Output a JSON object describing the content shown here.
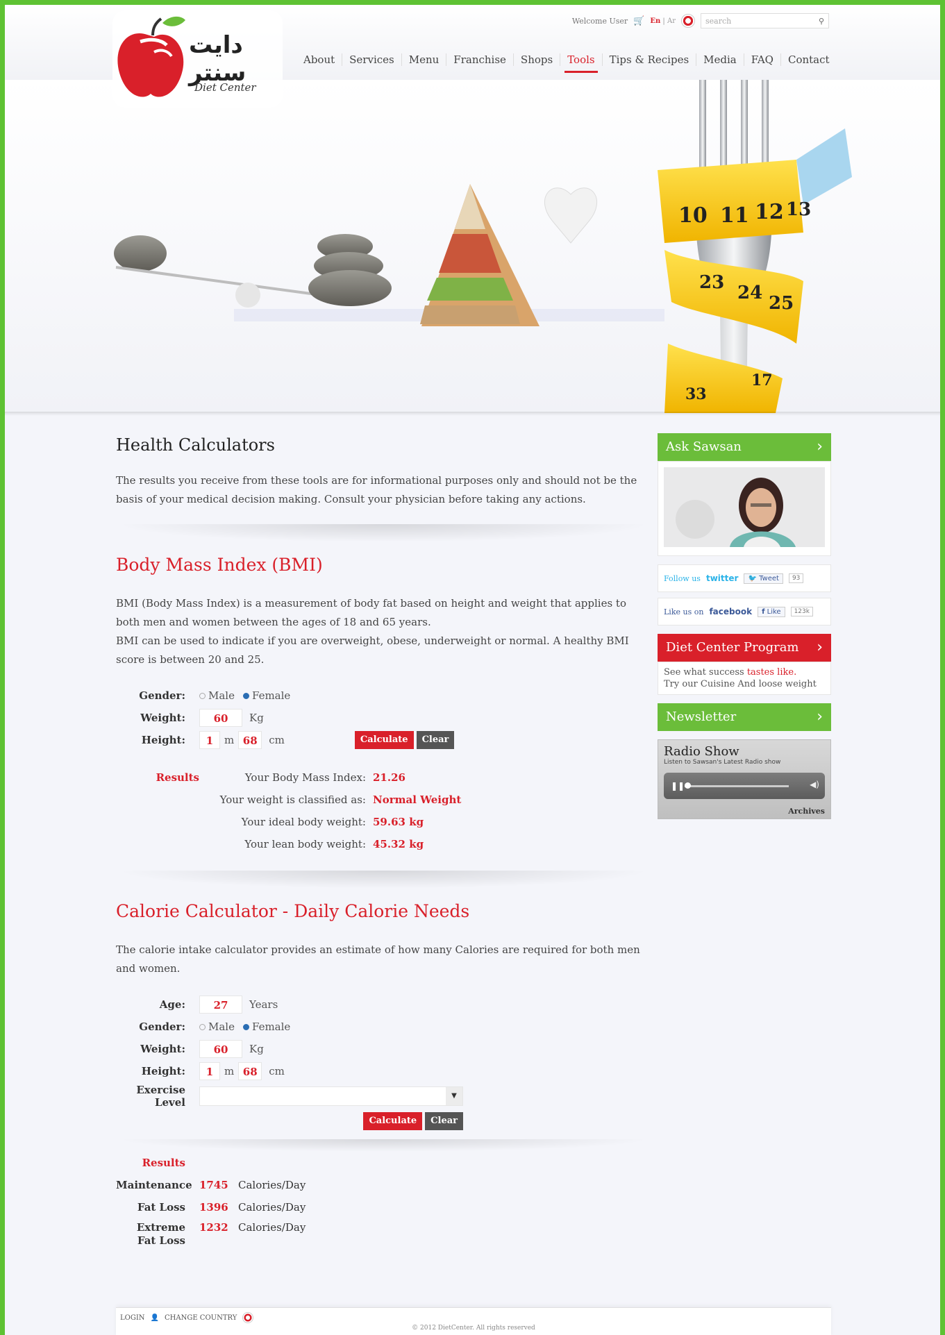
{
  "header": {
    "welcome": "Welcome User",
    "lang_en": "En",
    "lang_sep": " | ",
    "lang_ar": "Ar",
    "search_placeholder": "search",
    "logo_ar": "دايت سنتر",
    "logo_en": "Diet Center",
    "nav": [
      "About",
      "Services",
      "Menu",
      "Franchise",
      "Shops",
      "Tools",
      "Tips & Recipes",
      "Media",
      "FAQ",
      "Contact"
    ],
    "active_nav": "Tools"
  },
  "hero": {
    "tape_numbers": [
      "10",
      "11",
      "12",
      "13",
      "23",
      "24",
      "25",
      "17",
      "33"
    ]
  },
  "main": {
    "title": "Health Calculators",
    "intro": "The results you receive from these tools are for informational purposes only and should not be the basis of your medical decision making. Consult your physician before taking any actions.",
    "bmi": {
      "title": "Body Mass Index (BMI)",
      "desc1": "BMI (Body Mass Index) is a measurement of body fat based on height and weight that applies to both men and women between the ages of 18 and 65 years.",
      "desc2": "BMI can be used to indicate if you are overweight, obese, underweight or normal. A healthy BMI score is between 20 and 25.",
      "gender_label": "Gender:",
      "male": "Male",
      "female": "Female",
      "weight_label": "Weight:",
      "weight": "60",
      "weight_unit": "Kg",
      "height_label": "Height:",
      "height_m": "1",
      "m_unit": "m",
      "height_cm": "68",
      "cm_unit": "cm",
      "calculate": "Calculate",
      "clear": "Clear",
      "results_label": "Results",
      "results": [
        {
          "label": "Your Body Mass Index:",
          "value": "21.26"
        },
        {
          "label": "Your weight is classified as:",
          "value": "Normal Weight"
        },
        {
          "label": "Your ideal body weight:",
          "value": "59.63 kg"
        },
        {
          "label": "Your lean body weight:",
          "value": "45.32 kg"
        }
      ]
    },
    "calorie": {
      "title": "Calorie Calculator - Daily Calorie Needs",
      "desc": "The calorie intake calculator provides an estimate of how many Calories are required for both men and women.",
      "age_label": "Age:",
      "age": "27",
      "age_unit": "Years",
      "gender_label": "Gender:",
      "male": "Male",
      "female": "Female",
      "weight_label": "Weight:",
      "weight": "60",
      "weight_unit": "Kg",
      "height_label": "Height:",
      "height_m": "1",
      "m_unit": "m",
      "height_cm": "68",
      "cm_unit": "cm",
      "exercise_label": "Exercise Level",
      "exercise_value": "",
      "calculate": "Calculate",
      "clear": "Clear",
      "results_label": "Results",
      "results": [
        {
          "label": "Maintenance",
          "value": "1745",
          "unit": "Calories/Day"
        },
        {
          "label": "Fat Loss",
          "value": "1396",
          "unit": "Calories/Day"
        },
        {
          "label": "Extreme Fat Loss",
          "value": "1232",
          "unit": "Calories/Day"
        }
      ]
    }
  },
  "sidebar": {
    "ask_title": "Ask Sawsan",
    "twitter_prefix": "Follow us",
    "twitter_brand": "twitter",
    "tweet_btn": "Tweet",
    "tweet_count": "93",
    "fb_prefix": "Like us on",
    "fb_brand": "facebook",
    "like_btn": "Like",
    "like_count": "123k",
    "program_title": "Diet Center Program",
    "program_line1_a": "See what success ",
    "program_line1_b": "tastes like.",
    "program_line2": "Try our Cuisine And loose weight",
    "newsletter": "Newsletter",
    "radio_title": "Radio Show",
    "radio_sub": "Listen to Sawsan's Latest Radio show",
    "archives": "Archives"
  },
  "footer": {
    "login": "LOGIN",
    "change_country": "CHANGE COUNTRY",
    "copyright": "© 2012 DietCenter. All rights reserved"
  },
  "colors": {
    "brand_red": "#d9202a",
    "brand_green": "#6bbd3a",
    "frame_green": "#5ec233"
  }
}
